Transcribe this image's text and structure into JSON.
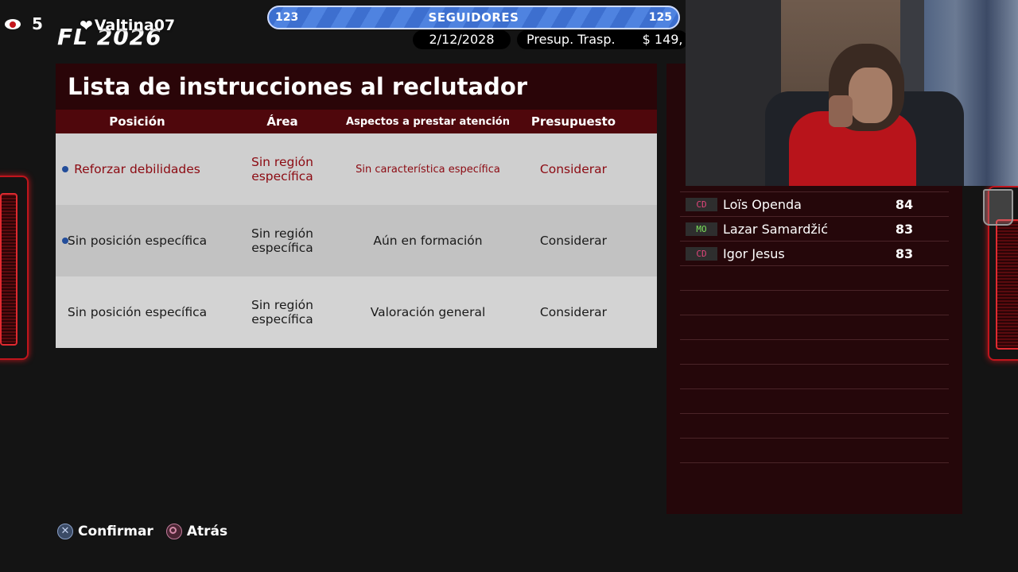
{
  "overlay": {
    "viewer_count": "5",
    "brand": "FL 2026",
    "follower_name": "Valtina07"
  },
  "followers_bar": {
    "left_value": "123",
    "label": "SEGUIDORES",
    "right_value": "125"
  },
  "status": {
    "date": "2/12/2028",
    "budget_label": "Presup. Trasp.",
    "budget_value": "$ 149,"
  },
  "panel": {
    "title": "Lista de instrucciones al reclutador",
    "columns": [
      "Posición",
      "Área",
      "Aspectos a prestar atención",
      "Presupuesto"
    ],
    "rows": [
      {
        "position": "Reforzar debilidades",
        "area": "Sin región específica",
        "aspect": "Sin característica específica",
        "budget": "Considerar",
        "marked": true,
        "selected": true
      },
      {
        "position": "Sin posición específica",
        "area": "Sin región específica",
        "aspect": "Aún en formación",
        "budget": "Considerar",
        "marked": true,
        "selected": false
      },
      {
        "position": "Sin posición específica",
        "area": "Sin región específica",
        "aspect": "Valoración general",
        "budget": "Considerar",
        "marked": false,
        "selected": false
      }
    ]
  },
  "players": [
    {
      "pos": "CD",
      "pos_color": "#e0457a",
      "name": "Loïs Openda",
      "rating": "84"
    },
    {
      "pos": "MO",
      "pos_color": "#7be05a",
      "name": "Lazar Samardžić",
      "rating": "83"
    },
    {
      "pos": "CD",
      "pos_color": "#e0457a",
      "name": "Igor Jesus",
      "rating": "83"
    }
  ],
  "footer": {
    "confirm_label": "Confirmar",
    "back_label": "Atrás"
  },
  "colors": {
    "accent_red": "#c0151c",
    "selected_text": "#8c0a12",
    "bullet_blue": "#234d9a",
    "followers_blue": "#4f83e0"
  }
}
